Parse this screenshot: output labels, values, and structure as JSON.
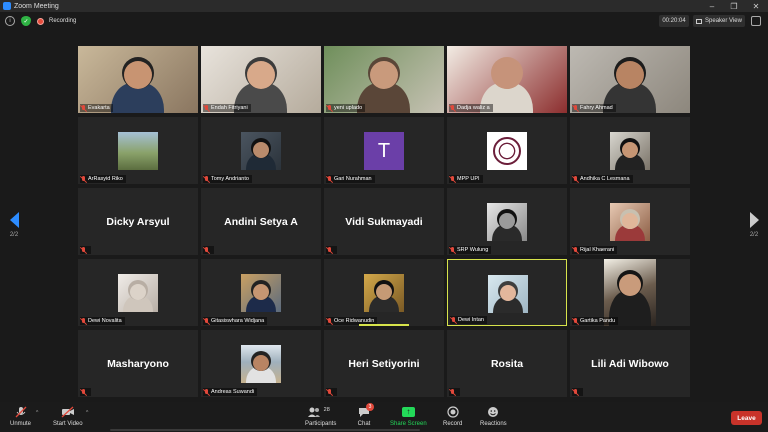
{
  "window": {
    "title": "Zoom Meeting",
    "minimize": "–",
    "maximize": "❐",
    "close": "✕"
  },
  "topbar": {
    "recording_label": "Recording",
    "timer": "00:20:04",
    "view_label": "Speaker View"
  },
  "nav": {
    "page_left": "2/2",
    "page_right": "2/2"
  },
  "participants": [
    {
      "name": "Evakarta",
      "photo": "man-glasses"
    },
    {
      "name": "Endah Fitriyani",
      "photo": "woman-hijab"
    },
    {
      "name": "yeni uplado",
      "photo": "woman-hijab-plant"
    },
    {
      "name": "Dadja waliz a",
      "photo": "man-bald"
    },
    {
      "name": "Fahry Ahmad",
      "photo": "man-young"
    },
    {
      "name": "ArRasyid Riko",
      "photo": "landscape"
    },
    {
      "name": "Tomy Andrianto",
      "photo": "man-portrait"
    },
    {
      "name": "Gari Nurahman",
      "photo": "letter-avatar",
      "avatar_letter": "T",
      "avatar_color": "#6b3fa8"
    },
    {
      "name": "MPP UPI",
      "photo": "logo"
    },
    {
      "name": "Andhika C Lesmana",
      "photo": "couple"
    },
    {
      "name": "Dicky Arsyul",
      "display_name": "Dicky Arsyul"
    },
    {
      "name": "Andini Setya A",
      "display_name": "Andini Setya A"
    },
    {
      "name": "Vidi Sukmayadi",
      "display_name": "Vidi Sukmayadi"
    },
    {
      "name": "SRP Wulung",
      "photo": "bw-man"
    },
    {
      "name": "Rijal Khaerani",
      "photo": "group"
    },
    {
      "name": "Dewi Novalita",
      "photo": "cat"
    },
    {
      "name": "Gitasiswhara Widjana",
      "photo": "man-suit"
    },
    {
      "name": "Oce Ridwanudin",
      "photo": "event"
    },
    {
      "name": "Dewi Intan",
      "photo": "woman-hijab-light",
      "active": true
    },
    {
      "name": "Gartika Pandu",
      "photo": "woman-lamp"
    },
    {
      "name": "Masharyono",
      "display_name": "Masharyono"
    },
    {
      "name": "Andreas Suwandi",
      "photo": "beach"
    },
    {
      "name": "Heri Setiyorini",
      "display_name": "Heri Setiyorini"
    },
    {
      "name": "Rosita",
      "display_name": "Rosita"
    },
    {
      "name": "Lili Adi Wibowo",
      "display_name": "Lili Adi Wibowo"
    }
  ],
  "toolbar": {
    "unmute": "Unmute",
    "start_video": "Start Video",
    "participants": "Participants",
    "participants_count": "28",
    "chat": "Chat",
    "chat_badge": "3",
    "share_screen": "Share Screen",
    "record": "Record",
    "reactions": "Reactions",
    "leave": "Leave"
  },
  "colors": {
    "accent": "#2d8cff",
    "active_speaker": "#d7e34b",
    "leave": "#c8332a",
    "share": "#23d959",
    "muted": "#e2493b"
  }
}
